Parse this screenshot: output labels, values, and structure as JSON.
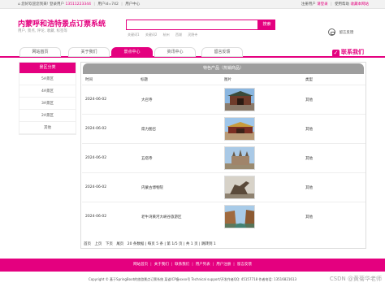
{
  "topbar": {
    "welcome": "您好欢迎您到來! 登录用户",
    "phone": "13511223344",
    "user": "用户id=742",
    "center": "用户中心",
    "register": "注册用户",
    "login": "请登录",
    "help": "使用帮助",
    "favorite": "收藏本网站"
  },
  "header": {
    "title": "内蒙呼和浩特景点订票系统",
    "subtitle": "用户, 景点, 评论, 收藏, 标签等",
    "search_placeholder": "",
    "search_button": "搜索",
    "hotwords": [
      "关键词1",
      "关键词2",
      "杭州",
      "西湖",
      "灵隐寺"
    ],
    "message": "留言反馈"
  },
  "nav": {
    "items": [
      "网站首页",
      "关于我们",
      "景点中心",
      "资讯中心",
      "留言反馈"
    ],
    "active": "景点中心",
    "contact": "联系我们"
  },
  "sidebar": {
    "title": "景区分类",
    "items": [
      "5A景区",
      "4A景区",
      "3A景区",
      "2A景区",
      "其他"
    ]
  },
  "main": {
    "title": "特色产品（热销商品）",
    "columns": [
      "时间",
      "标题",
      "图片",
      "类型"
    ],
    "rows": [
      {
        "date": "2024-06-02",
        "title": "大召寺",
        "type": "其他"
      },
      {
        "date": "2024-06-02",
        "title": "席力图召",
        "type": "其他"
      },
      {
        "date": "2024-06-02",
        "title": "五塔寺",
        "type": "其他"
      },
      {
        "date": "2024-06-02",
        "title": "内蒙古博物院",
        "type": "其他"
      },
      {
        "date": "2024-06-02",
        "title": "老牛湾黄河大峡谷旅游区",
        "type": "其他"
      }
    ],
    "pager": {
      "first": "首页",
      "prev": "上页",
      "next": "下页",
      "last": "尾页",
      "info": "20 条数据 | 每页 5 条 | 第 1/5 页 | 共 1 页 | 跳转到 1"
    }
  },
  "footer": {
    "links": [
      "网站首页",
      "关于我们",
      "联系我们",
      "用户列表",
      "用户注册",
      "留言反馈"
    ],
    "copyright": "Copyright © 基于SpringBoot的旅游景点订票系统   某省ICP备xxxx号   Technical support/开发作者QQ: 45157718   作者电话: 13516821613",
    "watermark": "CSDN @黄菊华老师"
  },
  "colors": {
    "accent": "#e4007f",
    "header_gray": "#9e9e9e"
  }
}
